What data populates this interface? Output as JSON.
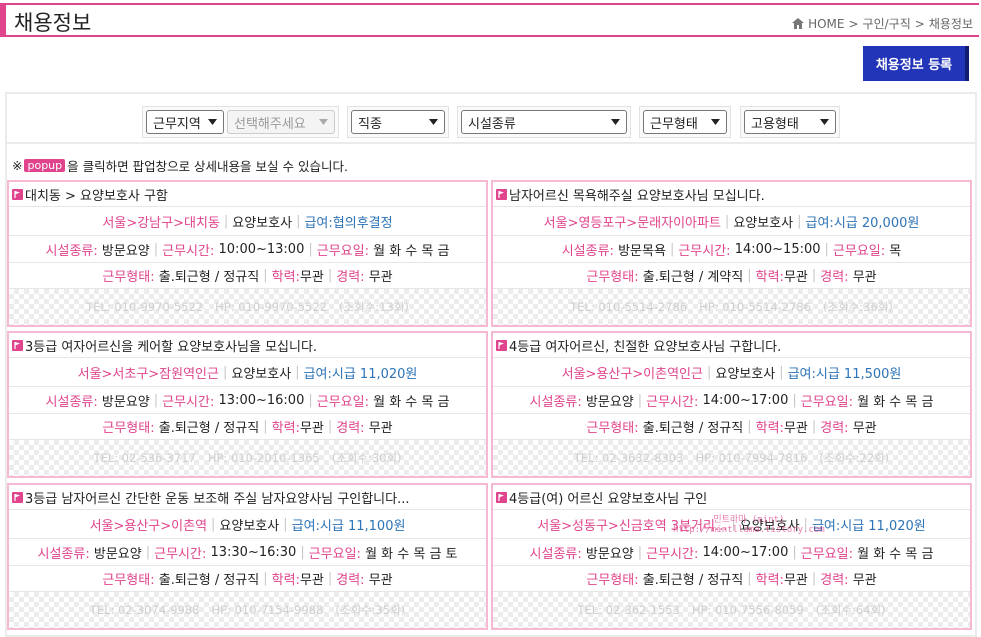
{
  "header": {
    "title": "채용정보",
    "breadcrumb": [
      "HOME",
      ">",
      "구인/구직",
      ">",
      "채용정보"
    ]
  },
  "register_label": "채용정보 등록",
  "filters": {
    "region_label": "근무지역",
    "region_sub_placeholder": "선택해주세요",
    "job_label": "직종",
    "facility_label": "시설종류",
    "worktype_label": "근무형태",
    "employ_label": "고용형태"
  },
  "notice": {
    "prefix": "※",
    "badge": "popup",
    "text": "을 클릭하면 팝업창으로 상세내용을 보실 수 있습니다."
  },
  "labels": {
    "facility": "시설종류:",
    "hours": "근무시간:",
    "days": "근무요일:",
    "worktype": "근무형태:",
    "edu": "학력:",
    "career": "경력:"
  },
  "listings": [
    {
      "title": "대치동 > 요양보호사 구함",
      "location": "서울>강남구>대치동",
      "job": "요양보호사",
      "pay": "급여:협의후결정",
      "facility": "방문요양",
      "hours": "10:00~13:00",
      "days": "월 화 수 목 금",
      "worktype": "출.퇴근형 / 정규직",
      "edu": "무관",
      "career": "무관",
      "tel": "TEL: 010-9970-5522",
      "hp": "HP: 010-9970-5522",
      "views": "(조회수:13회)"
    },
    {
      "title": "남자어르신 목욕해주실 요양보호사님 모십니다.",
      "location": "서울>영등포구>문래자이아파트",
      "job": "요양보호사",
      "pay": "급여:시급 20,000원",
      "facility": "방문목욕",
      "hours": "14:00~15:00",
      "days": "목",
      "worktype": "출.퇴근형 / 계약직",
      "edu": "무관",
      "career": "무관",
      "tel": "TEL: 010-5514-2786",
      "hp": "HP: 010-5514-2786",
      "views": "(조회수:36회)"
    },
    {
      "title": "3등급 여자어르신을 케어할 요양보호사님을 모십니다.",
      "location": "서울>서초구>잠원역인근",
      "job": "요양보호사",
      "pay": "급여:시급 11,020원",
      "facility": "방문요양",
      "hours": "13:00~16:00",
      "days": "월 화 수 목 금",
      "worktype": "출.퇴근형 / 정규직",
      "edu": "무관",
      "career": "무관",
      "tel": "TEL: 02-536-3717",
      "hp": "HP: 010-2010-1365",
      "views": "(조회수:30회)"
    },
    {
      "title": "4등급 여자어르신, 친절한 요양보호사님 구합니다.",
      "location": "서울>용산구>이촌역인근",
      "job": "요양보호사",
      "pay": "급여:시급 11,500원",
      "facility": "방문요양",
      "hours": "14:00~17:00",
      "days": "월 화 수 목 금",
      "worktype": "출.퇴근형 / 정규직",
      "edu": "무관",
      "career": "무관",
      "tel": "TEL: 02-3632-8303",
      "hp": "HP: 010-7994-7816",
      "views": "(조회수:22회)"
    },
    {
      "title": "3등급 남자어르신 간단한 운동 보조해 주실 남자요양사님 구인합니다...",
      "location": "서울>용산구>이촌역",
      "job": "요양보호사",
      "pay": "급여:시급 11,100원",
      "facility": "방문요양",
      "hours": "13:30~16:30",
      "days": "월 화 수 목 금 토",
      "worktype": "출.퇴근형 / 정규직",
      "edu": "무관",
      "career": "무관",
      "tel": "TEL: 02-3074-9988",
      "hp": "HP: 010-7154-9988",
      "views": "(조회수:35회)"
    },
    {
      "title": "4등급(여) 어르신 요양보호사님 구인",
      "location": "서울>성동구>신금호역 3분거리...",
      "job": "요양보호사",
      "pay": "급여:시급 11,020원",
      "facility": "방문요양",
      "hours": "14:00~17:00",
      "days": "월 화 수 목 금",
      "worktype": "출.퇴근형 / 정규직",
      "edu": "무관",
      "career": "무관",
      "tel": "TEL: 02-362-1553",
      "hp": "HP: 010-7556-8059",
      "views": "(조회수:64회)"
    }
  ],
  "watermark": {
    "line1": "민트라마 (mint)",
    "line2": "http://mintllama.tistory.com"
  },
  "colors": {
    "accent_pink": "#e0448c",
    "button_blue": "#2234b8",
    "pay_blue": "#2d73b6"
  }
}
